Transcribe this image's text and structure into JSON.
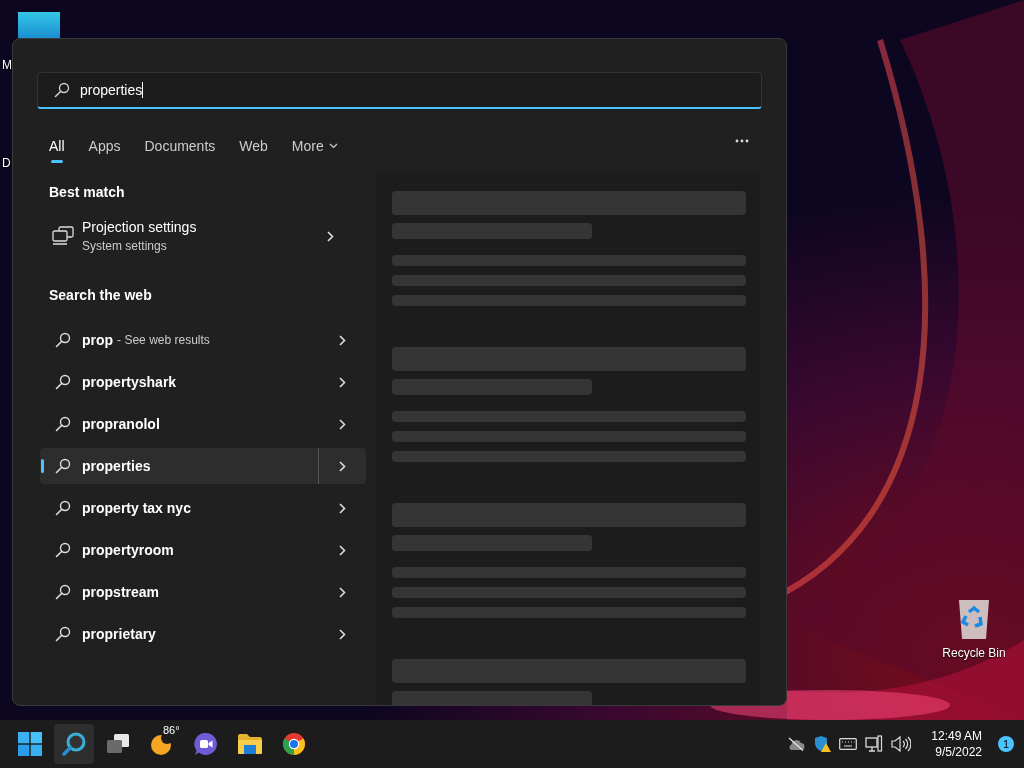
{
  "desktop": {
    "icons": [
      {
        "kind": "app",
        "label": "M"
      },
      {
        "kind": "app",
        "label": "D"
      },
      {
        "kind": "recycle",
        "label": "Recycle Bin"
      }
    ]
  },
  "search": {
    "query": "properties"
  },
  "tabs": [
    {
      "label": "All",
      "selected": true
    },
    {
      "label": "Apps",
      "selected": false
    },
    {
      "label": "Documents",
      "selected": false
    },
    {
      "label": "Web",
      "selected": false
    },
    {
      "label": "More",
      "selected": false
    }
  ],
  "best_match": {
    "heading": "Best match",
    "title": "Projection settings",
    "subtitle": "System settings"
  },
  "web": {
    "heading": "Search the web",
    "suggestions": [
      {
        "text": "prop",
        "hint": "- See web results",
        "selected": false
      },
      {
        "text": "propertyshark",
        "selected": false
      },
      {
        "text": "propranolol",
        "selected": false
      },
      {
        "text": "properties",
        "selected": true
      },
      {
        "text": "property tax nyc",
        "selected": false
      },
      {
        "text": "propertyroom",
        "selected": false
      },
      {
        "text": "propstream",
        "selected": false
      },
      {
        "text": "proprietary",
        "selected": false
      }
    ]
  },
  "preview": {
    "loading": true
  },
  "taskbar": {
    "apps": [
      {
        "kind": "start",
        "selected": false
      },
      {
        "kind": "search",
        "selected": true
      },
      {
        "kind": "taskview",
        "selected": false
      },
      {
        "kind": "weather",
        "selected": false,
        "badge": "86°"
      },
      {
        "kind": "chat",
        "selected": false
      },
      {
        "kind": "files",
        "selected": false
      },
      {
        "kind": "browser",
        "selected": false
      }
    ],
    "clock": {
      "time": "12:49 AM",
      "date": "9/5/2022"
    },
    "notifications": "1"
  }
}
